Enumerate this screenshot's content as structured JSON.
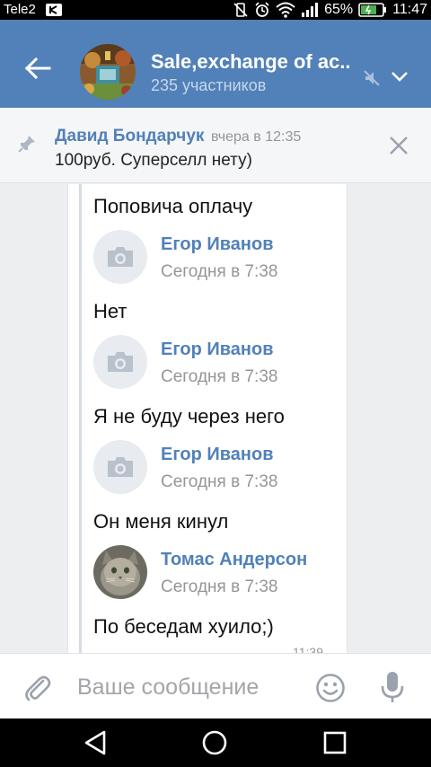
{
  "statusbar": {
    "carrier": "Tele2",
    "battery": "65%",
    "time": "11:47"
  },
  "header": {
    "title": "Sale,exchange of ac...",
    "subtitle": "235 участников",
    "icons": [
      "back-arrow-icon",
      "mute-icon",
      "chevron-down-icon"
    ]
  },
  "pinned": {
    "author": "Давид Бондарчук",
    "time": "вчера в 12:35",
    "text": "100руб. Суперселл нету)"
  },
  "messages": [
    {
      "type": "text",
      "text": "Поповича оплачу"
    },
    {
      "type": "author",
      "name": "Егор Иванов",
      "time": "Сегодня в 7:38",
      "avatar": "camera-placeholder"
    },
    {
      "type": "text",
      "text": "Нет"
    },
    {
      "type": "author",
      "name": "Егор Иванов",
      "time": "Сегодня в 7:38",
      "avatar": "camera-placeholder"
    },
    {
      "type": "text",
      "text": "Я не буду через него"
    },
    {
      "type": "author",
      "name": "Егор Иванов",
      "time": "Сегодня в 7:38",
      "avatar": "camera-placeholder"
    },
    {
      "type": "text",
      "text": "Он меня кинул"
    },
    {
      "type": "author",
      "name": "Томас Андерсон",
      "time": "Сегодня в 7:38",
      "avatar": "cat-photo"
    },
    {
      "type": "text",
      "text": "По беседам хуило;)"
    }
  ],
  "message_stamp": "11:39",
  "composer": {
    "placeholder": "Ваше сообщение"
  },
  "colors": {
    "header": "#5181b8",
    "link": "#5181b8",
    "background": "#edeef0"
  }
}
